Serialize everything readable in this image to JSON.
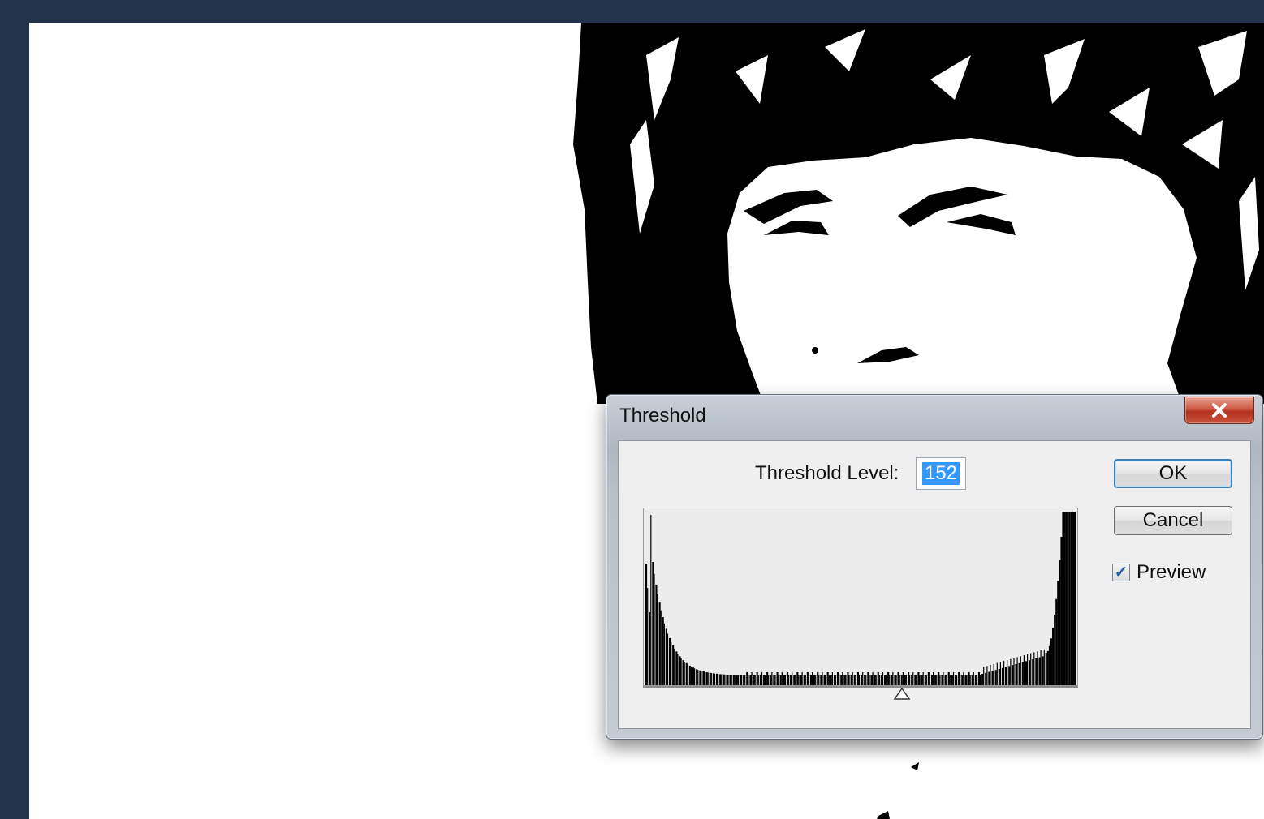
{
  "dialog": {
    "title": "Threshold",
    "threshold_label": "Threshold Level:",
    "threshold_value": "152",
    "ok_label": "OK",
    "cancel_label": "Cancel",
    "preview_label": "Preview",
    "preview_checked": true,
    "histogram": {
      "range": [
        0,
        255
      ],
      "slider_value": 152
    }
  },
  "icons": {
    "close": "close-icon",
    "checkmark": "checkmark-icon",
    "slider": "slider-triangle-icon"
  },
  "colors": {
    "desktop": "#24324a",
    "selection": "#3399ff",
    "close_button": "#c9503a"
  }
}
